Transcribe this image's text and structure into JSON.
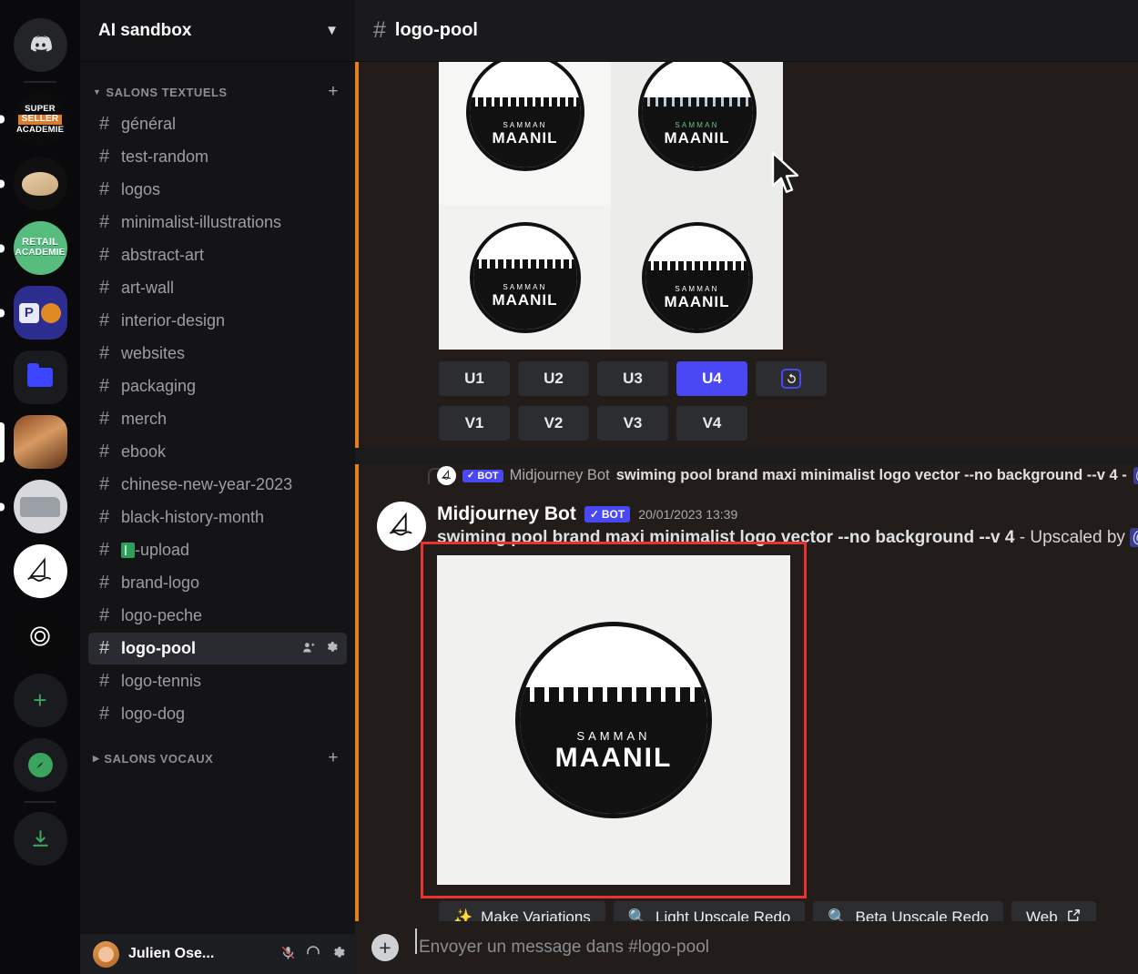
{
  "server_rail": {
    "items": [
      {
        "name": "discord-home",
        "label": "",
        "type": "discord"
      },
      {
        "name": "super-seller-academie",
        "label": "SUPER SELLER ACADEMIE",
        "lines": [
          "SUPER",
          "SELLER",
          "ACADEMIE"
        ],
        "type": "text"
      },
      {
        "name": "pig-server",
        "label": "",
        "type": "image"
      },
      {
        "name": "retail-academie",
        "label": "RETAIL ACADEMIE",
        "lines": [
          "RETAIL",
          "ACADEMIE"
        ],
        "type": "text"
      },
      {
        "name": "pp-server",
        "label": "",
        "type": "image"
      },
      {
        "name": "folder",
        "label": "",
        "type": "folder"
      },
      {
        "name": "wood-server",
        "label": "",
        "type": "image"
      },
      {
        "name": "car-server",
        "label": "",
        "type": "image"
      },
      {
        "name": "midjourney-server",
        "label": "",
        "type": "image"
      },
      {
        "name": "openai-server",
        "label": "",
        "type": "image"
      },
      {
        "name": "add-server",
        "label": "+",
        "type": "action"
      },
      {
        "name": "explore-servers",
        "label": "",
        "type": "action"
      },
      {
        "name": "download-apps",
        "label": "",
        "type": "action"
      }
    ]
  },
  "sidebar": {
    "server_name": "AI sandbox",
    "categories": [
      {
        "label": "SALONS TEXTUELS",
        "expanded": true,
        "channels": [
          {
            "name": "général",
            "active": false
          },
          {
            "name": "test-random",
            "active": false
          },
          {
            "name": "logos",
            "active": false
          },
          {
            "name": "minimalist-illustrations",
            "active": false
          },
          {
            "name": "abstract-art",
            "active": false
          },
          {
            "name": "art-wall",
            "active": false
          },
          {
            "name": "interior-design",
            "active": false
          },
          {
            "name": "websites",
            "active": false
          },
          {
            "name": "packaging",
            "active": false
          },
          {
            "name": "merch",
            "active": false
          },
          {
            "name": "ebook",
            "active": false
          },
          {
            "name": "chinese-new-year-2023",
            "active": false
          },
          {
            "name": "black-history-month",
            "active": false
          },
          {
            "name": "-upload",
            "emoji": true,
            "active": false
          },
          {
            "name": "brand-logo",
            "active": false
          },
          {
            "name": "logo-peche",
            "active": false
          },
          {
            "name": "logo-pool",
            "active": true
          },
          {
            "name": "logo-tennis",
            "active": false
          },
          {
            "name": "logo-dog",
            "active": false
          }
        ]
      },
      {
        "label": "SALONS VOCAUX",
        "expanded": false,
        "channels": []
      }
    ]
  },
  "user_panel": {
    "username": "Julien Ose...",
    "icons": [
      "mic-icon",
      "headphones-icon",
      "gear-icon"
    ]
  },
  "topbar": {
    "hash": "#",
    "channel_title": "logo-pool"
  },
  "messages": {
    "grid_message": {
      "upscale_buttons": [
        "U1",
        "U2",
        "U3",
        "U4"
      ],
      "active_upscale": "U4",
      "reroll_label": "reroll-icon",
      "variation_buttons": [
        "V1",
        "V2",
        "V3",
        "V4"
      ],
      "grid_logo_text_top": "SAMMAN",
      "grid_logo_text_bottom": "MAANIL"
    },
    "upscale_message": {
      "reply_preview": {
        "author": "Midjourney Bot",
        "bot_badge": "BOT",
        "text": "swiming pool brand maxi minimalist logo vector --no background --v 4 - "
      },
      "author": "Midjourney Bot",
      "bot_badge": "BOT",
      "timestamp": "20/01/2023 13:39",
      "prompt": "swiming pool brand maxi minimalist logo vector --no background --v 4",
      "suffix": " - Upscaled by ",
      "mention": "@",
      "logo_text_top": "SAMMAN",
      "logo_text_bottom": "MAANIL",
      "action_buttons": [
        {
          "label": "Make Variations",
          "icon": "sparkles-icon"
        },
        {
          "label": "Light Upscale Redo",
          "icon": "magnifier-icon"
        },
        {
          "label": "Beta Upscale Redo",
          "icon": "magnifier-icon"
        },
        {
          "label": "Web",
          "icon": "external-link-icon"
        }
      ]
    }
  },
  "composer": {
    "add_icon": "plus-circle-icon",
    "placeholder": "Envoyer un message dans #logo-pool"
  },
  "colors": {
    "accent_blurple": "#4a47f5",
    "orange_line": "#e0801f",
    "red_highlight": "#e8332f",
    "sidebar_bg": "#141416",
    "main_bg": "#221d1a"
  }
}
